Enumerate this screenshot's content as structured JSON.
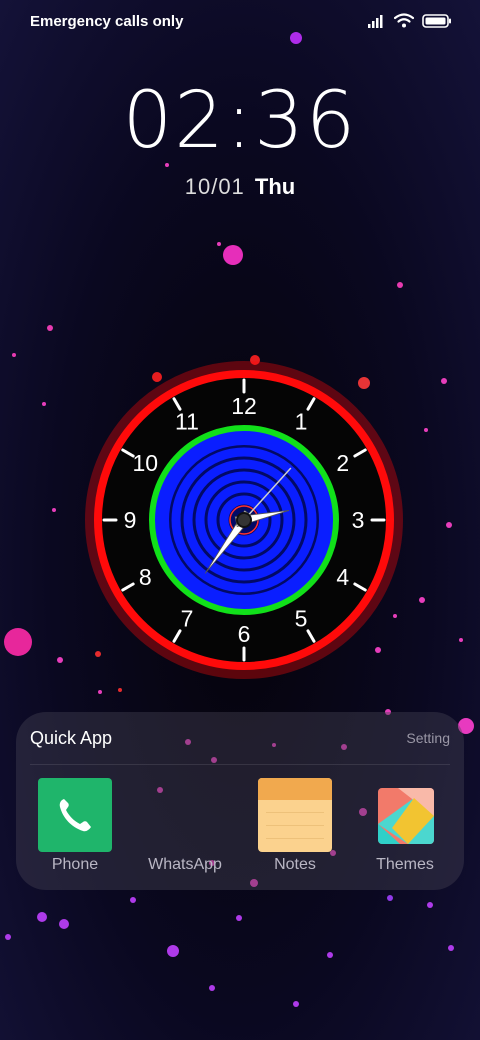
{
  "status_bar": {
    "carrier_text": "Emergency calls only",
    "icons": [
      "signal-icon",
      "wifi-icon",
      "battery-icon"
    ]
  },
  "lockscreen": {
    "time": "02:36",
    "date": "10/01",
    "weekday": "Thu"
  },
  "clock_widget": {
    "numbers": [
      "12",
      "1",
      "2",
      "3",
      "4",
      "5",
      "6",
      "7",
      "8",
      "9",
      "10",
      "11"
    ],
    "hour": 2,
    "minute": 36,
    "second": 7,
    "colors": {
      "outer_ring": "#ff0a0a",
      "inner_ring": "#11e01a",
      "dial_blue": "#0a1eff",
      "dark_blue": "#020a66"
    }
  },
  "quick_app": {
    "title": "Quick App",
    "setting_label": "Setting",
    "apps": [
      {
        "label": "Phone",
        "icon": "phone-icon",
        "color": "#1fb56b"
      },
      {
        "label": "WhatsApp",
        "icon": "none"
      },
      {
        "label": "Notes",
        "icon": "notes-icon",
        "color": "#fbd28e"
      },
      {
        "label": "Themes",
        "icon": "themes-icon"
      }
    ]
  }
}
